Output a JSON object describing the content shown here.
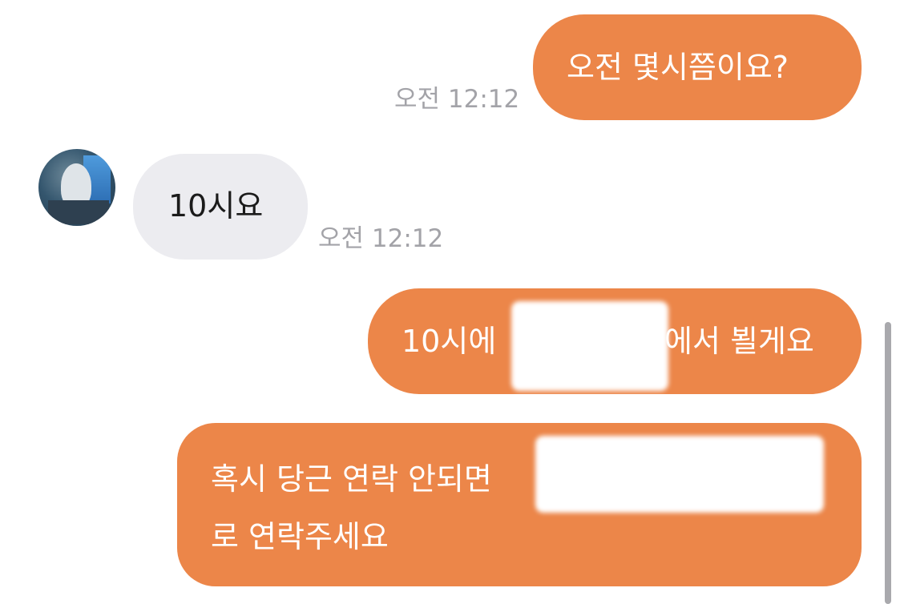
{
  "messages": [
    {
      "from": "me",
      "text": "오전 몇시쯤이요?",
      "time": "오전 12:12"
    },
    {
      "from": "other",
      "text": "10시요",
      "time": "오전 12:12"
    },
    {
      "from": "me",
      "part_before": "10시에",
      "part_after": "에서 뵐게요",
      "redacted": true
    },
    {
      "from": "me",
      "line1": "혹시 당근 연락 안되면",
      "line2": "로 연락주세요",
      "redacted": true
    }
  ],
  "colors": {
    "outgoing_bubble": "#ec8649",
    "incoming_bubble": "#ececf0",
    "timestamp": "#a3a3a8"
  }
}
